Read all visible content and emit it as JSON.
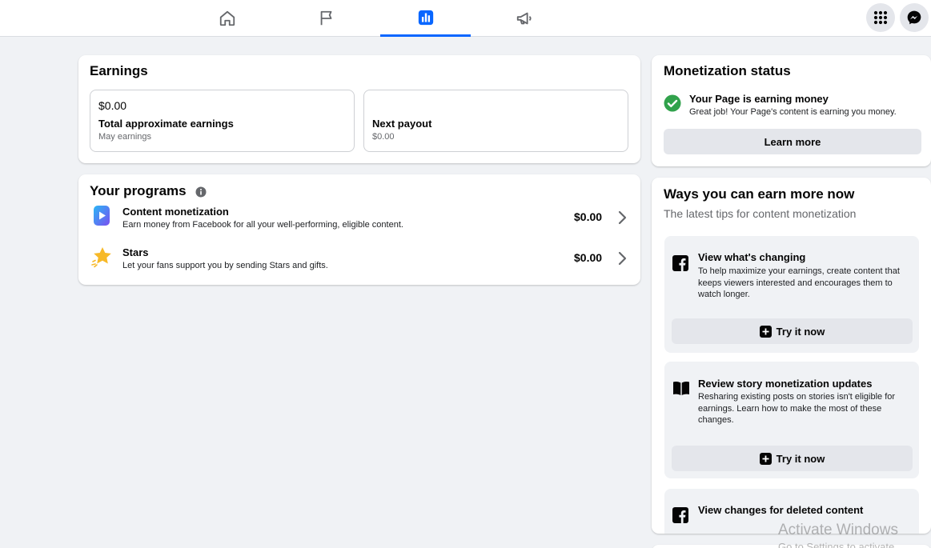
{
  "nav": {
    "tabs": [
      {
        "icon": "home-icon"
      },
      {
        "icon": "flag-icon"
      },
      {
        "icon": "insights-icon",
        "active": true
      },
      {
        "icon": "megaphone-icon"
      }
    ],
    "right_buttons": [
      {
        "icon": "menu-grid-icon"
      },
      {
        "icon": "messenger-icon"
      }
    ]
  },
  "earnings": {
    "title": "Earnings",
    "total": {
      "amount": "$0.00",
      "label": "Total approximate earnings",
      "sub": "May earnings"
    },
    "next": {
      "label": "Next payout",
      "sub": "$0.00"
    }
  },
  "programs": {
    "title": "Your programs",
    "items": [
      {
        "title": "Content monetization",
        "desc": "Earn money from Facebook for all your well-performing, eligible content.",
        "amount": "$0.00"
      },
      {
        "title": "Stars",
        "desc": "Let your fans support you by sending Stars and gifts.",
        "amount": "$0.00"
      }
    ]
  },
  "status": {
    "title": "Monetization status",
    "headline": "Your Page is earning money",
    "desc": "Great job! Your Page's content is earning you money.",
    "button": "Learn more"
  },
  "ways": {
    "title": "Ways you can earn more now",
    "subtitle": "The latest tips for content monetization",
    "tips": [
      {
        "title": "View what's changing",
        "desc": "To help maximize your earnings, create content that keeps viewers interested and encourages them to watch longer.",
        "button": "Try it now"
      },
      {
        "title": "Review story monetization updates",
        "desc": "Resharing existing posts on stories isn't eligible for earnings. Learn how to make the most of these changes.",
        "button": "Try it now"
      },
      {
        "title": "View changes for deleted content",
        "desc": ""
      }
    ]
  },
  "watermark": {
    "line1": "Activate Windows",
    "line2": "Go to Settings to activate Windows."
  },
  "colors": {
    "accent": "#0866ff",
    "success": "#31a24c"
  }
}
